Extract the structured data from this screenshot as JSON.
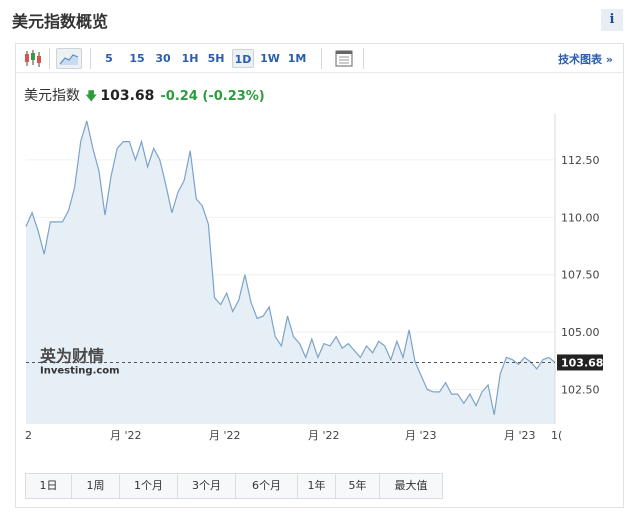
{
  "widget": {
    "title": "美元指数概览",
    "info_label": "i"
  },
  "toolbar": {
    "candle_icon": "candlestick-icon",
    "area_icon": "area-chart-icon",
    "timeframes": [
      "5",
      "15",
      "30",
      "1H",
      "5H",
      "1D",
      "1W",
      "1M"
    ],
    "active_timeframe": "1D",
    "calendar_icon": "calendar-icon",
    "tech_chart_link": "技术图表 »"
  },
  "quote": {
    "name": "美元指数",
    "arrow": "🡇",
    "price": "103.68",
    "change": "-0.24 (-0.23%)",
    "color_down": "#2e9c3c"
  },
  "watermark": {
    "brand": "英为财情",
    "sub": "Investing.com"
  },
  "chart_data": {
    "type": "area",
    "xlabel": "",
    "ylabel": "",
    "ylim": [
      101.0,
      114.5
    ],
    "y_ticks": [
      "112.50",
      "110.00",
      "107.50",
      "105.00",
      "102.50"
    ],
    "x_tick_labels": [
      "2",
      "月 '22",
      "月 '22",
      "月 '22",
      "月 '23",
      "月 '23",
      "1("
    ],
    "last_value_label": "103.68",
    "last_value": 103.68,
    "line_color": "#7ba3c9",
    "fill_color": "#e6eef6",
    "series": [
      {
        "values": [
          109.6,
          110.2,
          109.4,
          108.4,
          109.8,
          109.8,
          109.8,
          110.3,
          111.3,
          113.3,
          114.2,
          113.0,
          112.0,
          110.1,
          111.8,
          113.0,
          113.3,
          113.3,
          112.5,
          113.3,
          112.2,
          113.0,
          112.5,
          111.4,
          110.2,
          111.1,
          111.6,
          112.9,
          110.8,
          110.5,
          109.7,
          106.5,
          106.2,
          106.7,
          105.9,
          106.4,
          107.5,
          106.3,
          105.6,
          105.7,
          106.1,
          104.8,
          104.4,
          105.7,
          104.8,
          104.5,
          103.9,
          104.7,
          103.9,
          104.5,
          104.4,
          104.8,
          104.3,
          104.5,
          104.2,
          103.9,
          104.4,
          104.1,
          104.6,
          104.4,
          103.8,
          104.6,
          103.9,
          105.1,
          103.7,
          103.1,
          102.5,
          102.4,
          102.4,
          102.8,
          102.3,
          102.3,
          101.9,
          102.3,
          101.8,
          102.4,
          102.7,
          101.4,
          103.2,
          103.9,
          103.8,
          103.6,
          103.9,
          103.7,
          103.4,
          103.8,
          103.9,
          103.68
        ]
      }
    ]
  },
  "ranges": [
    "1日",
    "1周",
    "1个月",
    "3个月",
    "6个月",
    "1年",
    "5年",
    "最大值"
  ]
}
